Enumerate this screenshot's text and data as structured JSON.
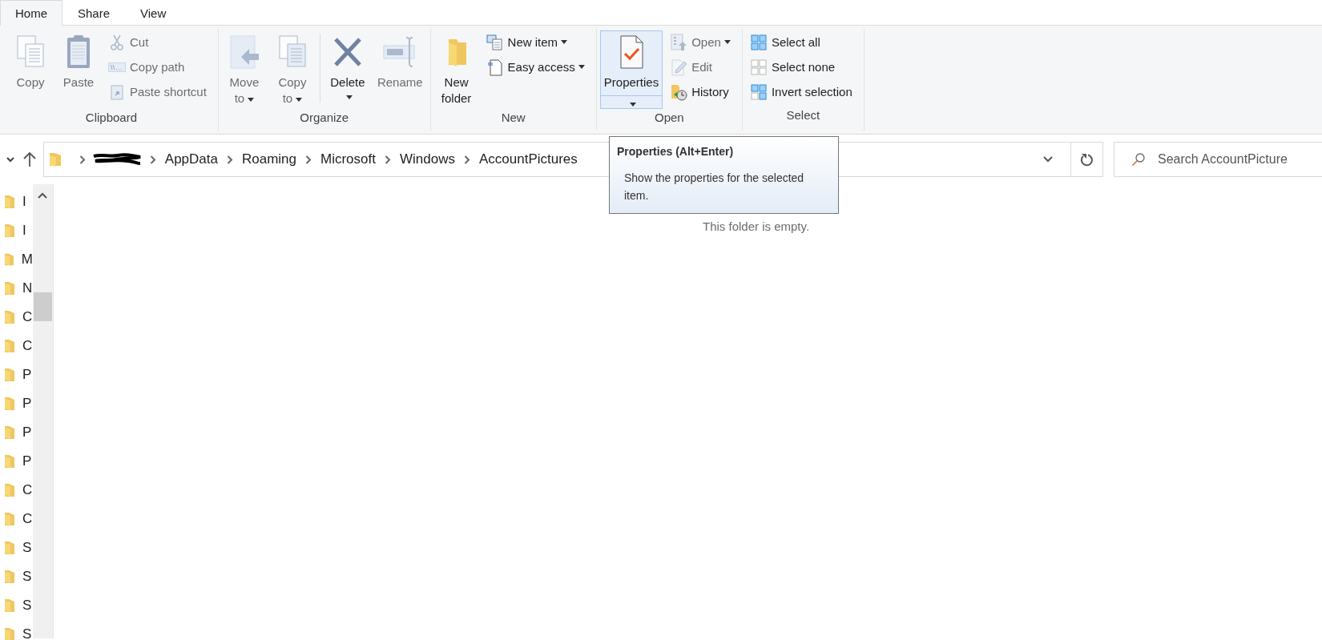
{
  "tabs": [
    {
      "label": "Home",
      "selected": true
    },
    {
      "label": "Share",
      "selected": false
    },
    {
      "label": "View",
      "selected": false
    }
  ],
  "ribbon": {
    "groups": [
      {
        "label": "Clipboard",
        "items": [
          {
            "kind": "large",
            "label": "Copy",
            "disabled": true,
            "highlighted": false
          },
          {
            "kind": "large",
            "label": "Paste",
            "disabled": true,
            "highlighted": false
          },
          {
            "kind": "stack",
            "items": [
              {
                "label": "Cut",
                "disabled": true
              },
              {
                "label": "Copy path",
                "disabled": true
              },
              {
                "label": "Paste shortcut",
                "disabled": true
              }
            ]
          }
        ]
      },
      {
        "label": "Organize",
        "items": [
          {
            "kind": "large",
            "label": "Move to",
            "disabled": true,
            "highlighted": false,
            "dropdown": true
          },
          {
            "kind": "large",
            "label": "Copy to",
            "disabled": true,
            "highlighted": false,
            "dropdown": true
          },
          {
            "kind": "separator"
          },
          {
            "kind": "split",
            "label": "Delete",
            "disabled": false,
            "highlighted": false
          },
          {
            "kind": "large",
            "label": "Rename",
            "disabled": true,
            "highlighted": false
          }
        ]
      },
      {
        "label": "New",
        "items": [
          {
            "kind": "large",
            "label": "New folder",
            "disabled": false,
            "highlighted": false
          },
          {
            "kind": "stack",
            "items": [
              {
                "label": "New item",
                "disabled": false,
                "dropdown": true
              },
              {
                "label": "Easy access",
                "disabled": false,
                "dropdown": true
              }
            ]
          }
        ]
      },
      {
        "label": "Open",
        "items": [
          {
            "kind": "split",
            "label": "Properties",
            "disabled": false,
            "highlighted": true
          },
          {
            "kind": "stack",
            "items": [
              {
                "label": "Open",
                "disabled": true,
                "dropdown": true
              },
              {
                "label": "Edit",
                "disabled": true,
                "dropdown": false
              },
              {
                "label": "History",
                "disabled": false,
                "dropdown": false
              }
            ]
          }
        ]
      },
      {
        "label": "Select",
        "items": [
          {
            "kind": "stack",
            "items": [
              {
                "label": "Select all",
                "disabled": false
              },
              {
                "label": "Select none",
                "disabled": false
              },
              {
                "label": "Invert selection",
                "disabled": false
              }
            ]
          }
        ]
      }
    ]
  },
  "address_bar": {
    "crumbs": [
      {
        "kind": "redacted"
      },
      {
        "kind": "folder",
        "label": "AppData"
      },
      {
        "kind": "folder",
        "label": "Roaming"
      },
      {
        "kind": "folder",
        "label": "Microsoft"
      },
      {
        "kind": "folder",
        "label": "Windows"
      },
      {
        "kind": "folder",
        "label": "AccountPictures"
      }
    ]
  },
  "search": {
    "placeholder": "Search AccountPicture"
  },
  "tooltip": {
    "title": "Properties (Alt+Enter)",
    "text": "Show the properties for the selected item."
  },
  "nav_pane": {
    "items": [
      {
        "label": "I"
      },
      {
        "label": "I"
      },
      {
        "label": "M"
      },
      {
        "label": "N"
      },
      {
        "label": "C"
      },
      {
        "label": "C"
      },
      {
        "label": "P"
      },
      {
        "label": "P"
      },
      {
        "label": "P"
      },
      {
        "label": "P"
      },
      {
        "label": "C"
      },
      {
        "label": "C"
      },
      {
        "label": "S"
      },
      {
        "label": "S"
      },
      {
        "label": "S"
      },
      {
        "label": "S"
      }
    ]
  },
  "content": {
    "empty_message": "This folder is empty."
  }
}
